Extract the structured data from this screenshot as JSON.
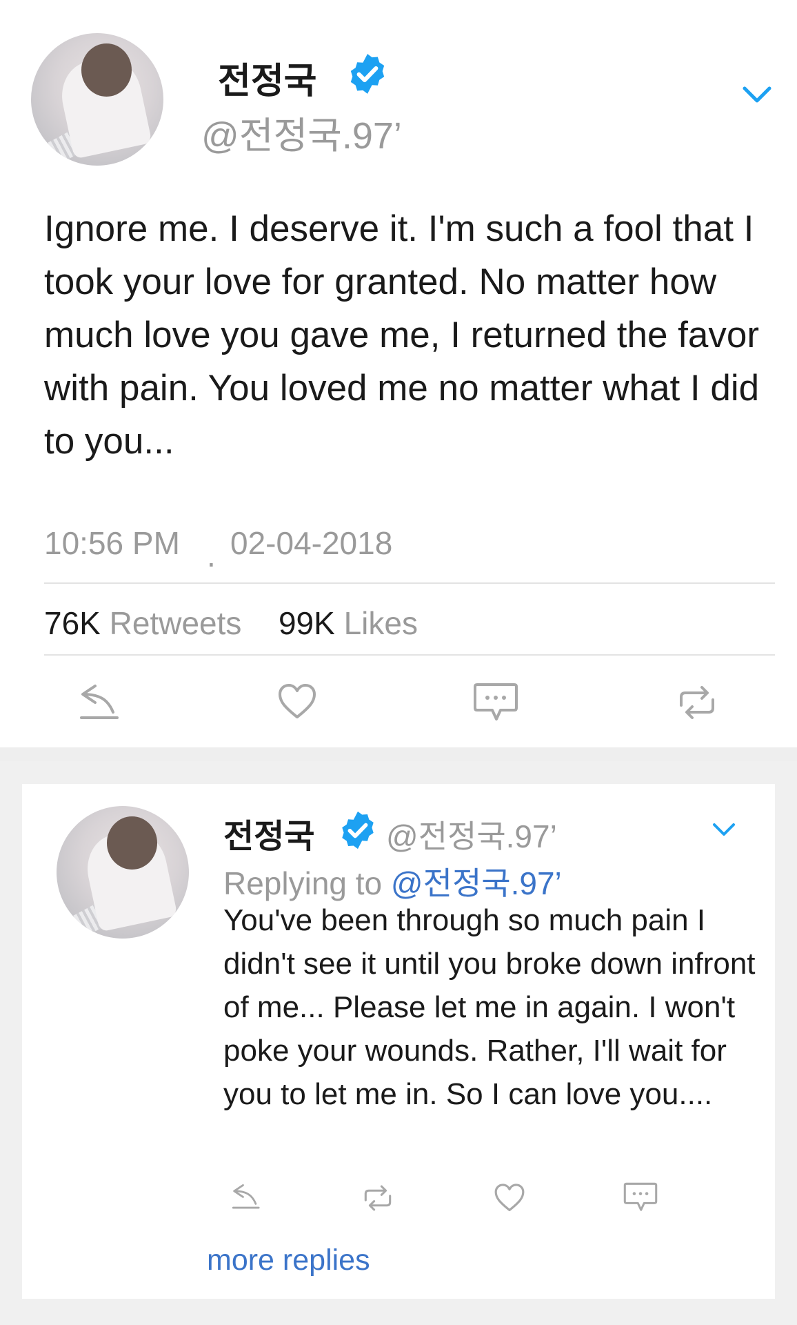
{
  "main_tweet": {
    "author_name": "전정국",
    "handle": "@전정국.97’",
    "text": "Ignore me. I deserve it. I'm such a fool that I took your love for granted. No matter how much love you gave me, I returned the favor with pain. You loved me no matter what I did to you...",
    "time": "10:56 PM",
    "separator": ".",
    "date": "02-04-2018",
    "retweets_count": "76K",
    "retweets_label": "Retweets",
    "likes_count": "99K",
    "likes_label": "Likes"
  },
  "reply_tweet": {
    "author_name": "전정국",
    "handle": "@전정국.97’",
    "replying_label": "Replying to",
    "replying_to": "@전정국.97’",
    "text": "You've been through so much pain I didn't see it until you broke down infront of me... Please let me in again. I won't poke your wounds. Rather, I'll wait for you to let me in. So I can love you...."
  },
  "more_replies_label": "more replies",
  "colors": {
    "accent": "#1da1f2",
    "link": "#3b74c9",
    "muted": "#9a9a9a",
    "text": "#1a1a1a"
  },
  "icons": {
    "verified": "verified-badge-icon",
    "dropdown": "chevron-down-icon",
    "reply": "reply-icon",
    "like": "heart-icon",
    "dm": "message-icon",
    "retweet": "retweet-icon"
  }
}
